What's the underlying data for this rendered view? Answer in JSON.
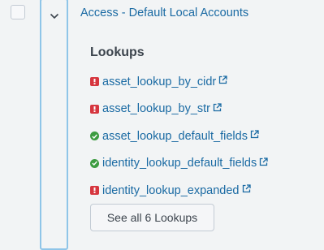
{
  "row": {
    "title": "Access - Default Local Accounts"
  },
  "lookups": {
    "heading": "Lookups",
    "items": [
      {
        "name": "asset_lookup_by_cidr",
        "status": "error"
      },
      {
        "name": "asset_lookup_by_str",
        "status": "error"
      },
      {
        "name": "asset_lookup_default_fields",
        "status": "ok"
      },
      {
        "name": "identity_lookup_default_fields",
        "status": "ok"
      },
      {
        "name": "identity_lookup_expanded",
        "status": "error"
      }
    ],
    "see_all_label": "See all 6 Lookups"
  },
  "icons": {
    "error": "error-status-icon",
    "ok": "ok-status-icon",
    "external": "external-link-icon",
    "expand": "chevron-down-icon"
  },
  "colors": {
    "link": "#1a6aa3",
    "error": "#d6363f",
    "ok": "#3d9c41",
    "focus": "#8fc5e8"
  }
}
